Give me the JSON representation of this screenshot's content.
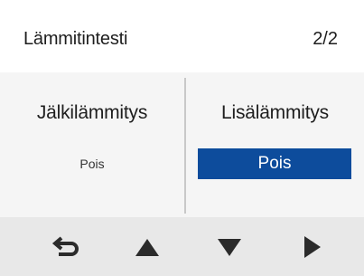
{
  "header": {
    "title": "Lämmitintesti",
    "page_indicator": "2/2"
  },
  "columns": [
    {
      "label": "Jälkilämmitys",
      "value": "Pois",
      "selected": false
    },
    {
      "label": "Lisälämmitys",
      "value": "Pois",
      "selected": true
    }
  ],
  "colors": {
    "accent": "#0d4c9c",
    "panel_bg": "#f5f5f5",
    "footer_bg": "#e8e8e8",
    "icon": "#2b2b2b"
  },
  "footer": {
    "buttons": [
      {
        "icon": "back-arrow-icon"
      },
      {
        "icon": "triangle-up-icon"
      },
      {
        "icon": "triangle-down-icon"
      },
      {
        "icon": "triangle-right-icon"
      }
    ]
  }
}
